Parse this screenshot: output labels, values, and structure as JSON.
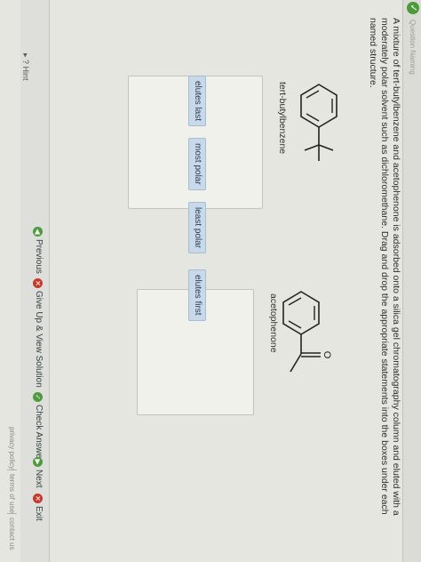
{
  "header": {
    "title": "Question Naming"
  },
  "question": {
    "text": "A mixture of tert-butylbenzene and acetophenone is adsorbed onto a silica gel chromatography column and eluted with a moderately polar solvent such as dichloromethane. Drag and drop the appropriate statements into the boxes under each named structure."
  },
  "structures": [
    {
      "name": "tert-butylbenzene"
    },
    {
      "name": "acetophenone"
    }
  ],
  "chips": [
    "elutes last",
    "most polar",
    "least polar",
    "elutes first"
  ],
  "hint": {
    "label": "Hint"
  },
  "nav": {
    "previous": "Previous",
    "give_up": "Give Up & View Solution",
    "check": "Check Answer",
    "next": "Next",
    "exit": "Exit"
  },
  "footer": [
    "privacy policy",
    "terms of use",
    "contact us"
  ],
  "colors": {
    "chip": "#c8d9ea",
    "green": "#4f9a3e",
    "red": "#c63a2e"
  }
}
